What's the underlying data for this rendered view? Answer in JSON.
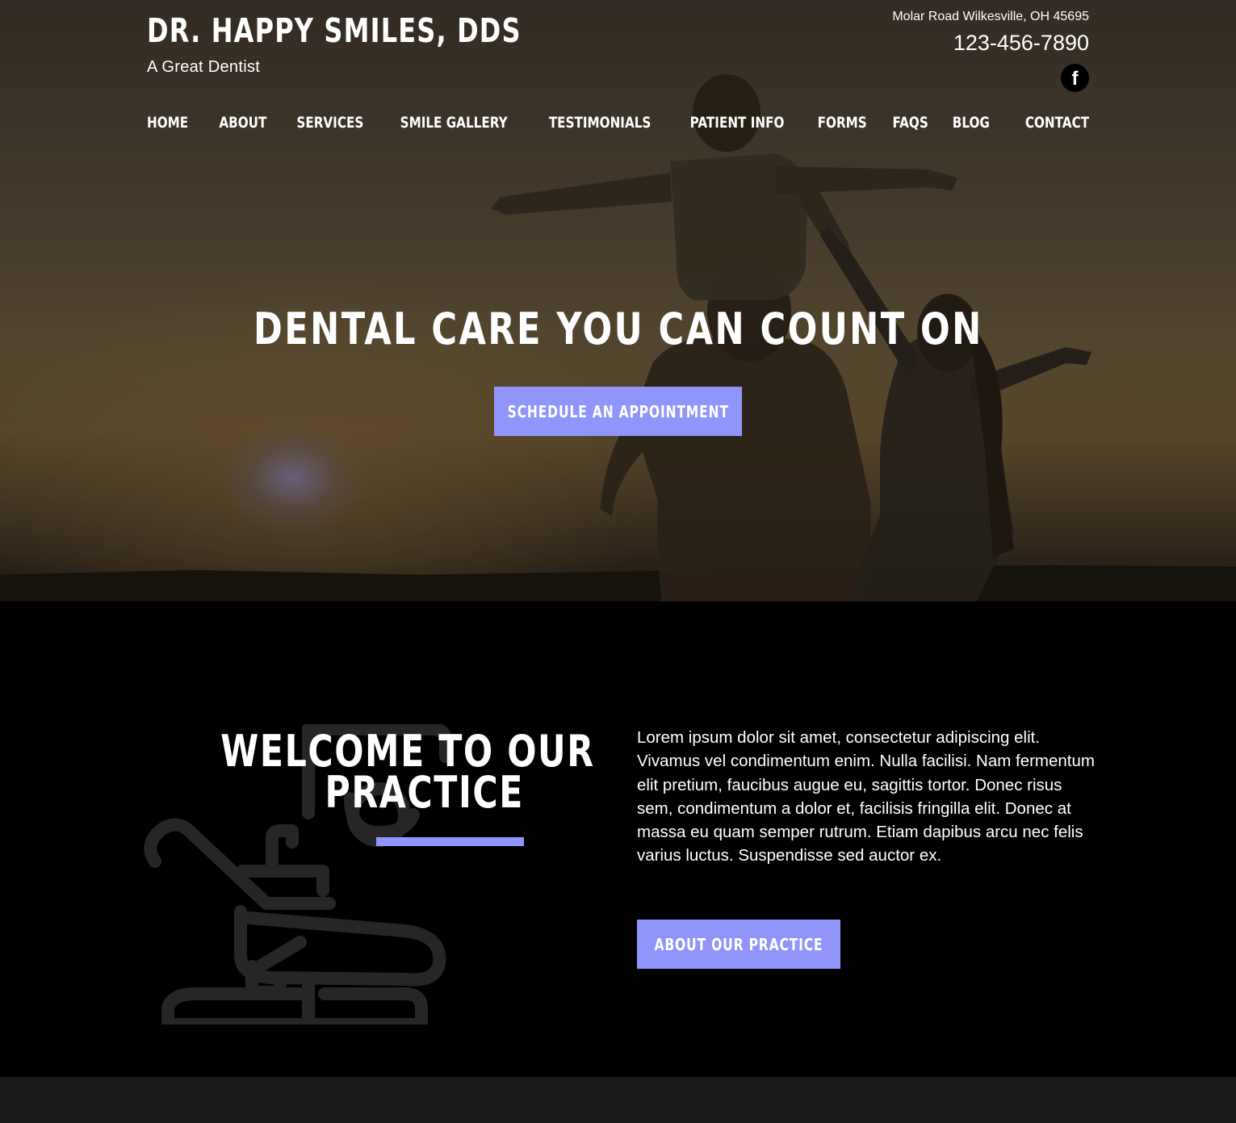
{
  "header": {
    "title": "DR. HAPPY SMILES, DDS",
    "tagline": "A Great Dentist",
    "address": "Molar Road Wilkesville, OH 45695",
    "phone": "123-456-7890",
    "social_icon": "facebook-icon",
    "social_glyph": "f"
  },
  "nav": {
    "items": [
      "HOME",
      "ABOUT",
      "SERVICES",
      "SMILE GALLERY",
      "TESTIMONIALS",
      "PATIENT INFO",
      "FORMS",
      "FAQS",
      "BLOG",
      "CONTACT"
    ]
  },
  "hero": {
    "heading": "DENTAL CARE YOU CAN COUNT ON",
    "cta_label": "SCHEDULE AN APPOINTMENT"
  },
  "welcome": {
    "heading_line1": "WELCOME TO OUR",
    "heading_line2": "PRACTICE",
    "body": "Lorem ipsum dolor sit amet, consectetur adipiscing elit. Vivamus vel condimentum enim. Nulla facilisi. Nam fermentum elit pretium, faucibus augue eu, sagittis tortor. Donec risus sem, condimentum a dolor et, facilisis fringilla elit. Donec at massa eu quam semper rutrum. Etiam dapibus arcu nec felis varius luctus. Suspendisse sed auctor ex.",
    "cta_label": "ABOUT OUR PRACTICE",
    "background_icon": "dental-chair-icon"
  },
  "colors": {
    "accent": "#8f95fb",
    "section_background": "#000000",
    "footer_background": "#1a1a1a"
  }
}
